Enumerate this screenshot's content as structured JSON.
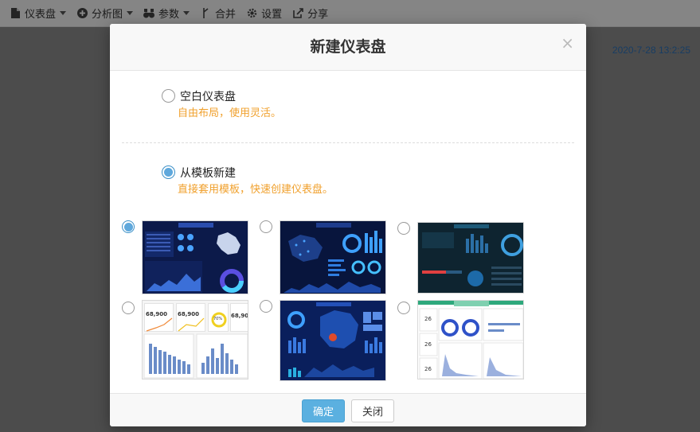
{
  "toolbar": {
    "items": [
      {
        "label": "仪表盘",
        "icon": "file-icon",
        "dropdown": true
      },
      {
        "label": "分析图",
        "icon": "plus-circle-icon",
        "dropdown": true
      },
      {
        "label": "参数",
        "icon": "binoculars-icon",
        "dropdown": true
      },
      {
        "label": "合并",
        "icon": "merge-icon",
        "dropdown": false
      },
      {
        "label": "设置",
        "icon": "gear-icon",
        "dropdown": false
      },
      {
        "label": "分享",
        "icon": "share-icon",
        "dropdown": false
      }
    ]
  },
  "timestamp": "2020-7-28 13:2:25",
  "dialog": {
    "title": "新建仪表盘",
    "close": "×",
    "options": [
      {
        "label": "空白仪表盘",
        "desc": "自由布局，使用灵活。",
        "selected": false
      },
      {
        "label": "从模板新建",
        "desc": "直接套用模板，快速创建仪表盘。",
        "selected": true
      }
    ],
    "templates": [
      {
        "theme": "dark-blue-map",
        "selected": true
      },
      {
        "theme": "dark-navy-map",
        "selected": false
      },
      {
        "theme": "dark-teal-stats",
        "selected": false
      },
      {
        "theme": "light-kpi",
        "selected": false
      },
      {
        "theme": "dark-blue-map-2",
        "selected": false
      },
      {
        "theme": "light-donut",
        "selected": false
      }
    ],
    "template_kpi": {
      "value": "68,900",
      "pct": "70%"
    },
    "template_light2_row": "26",
    "ok_label": "确定",
    "close_label": "关闭"
  },
  "colors": {
    "accent": "#5bb0e0",
    "desc": "#f0a02c",
    "timestamp": "#2d6fb5"
  }
}
